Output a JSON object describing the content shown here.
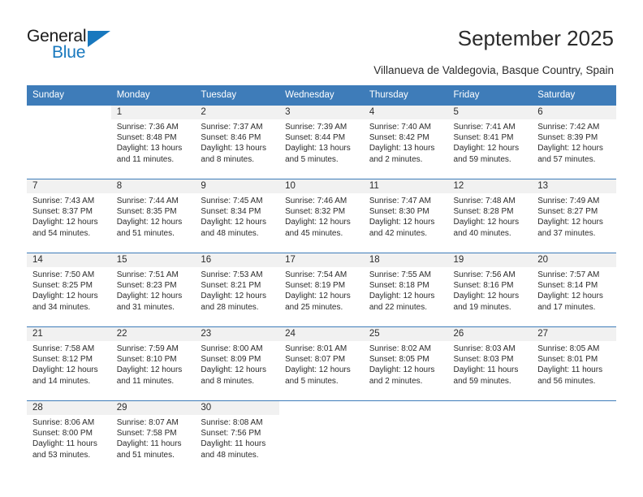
{
  "brand": {
    "name_part1": "General",
    "name_part2": "Blue",
    "accent_color": "#1878be"
  },
  "header": {
    "title": "September 2025",
    "subtitle": "Villanueva de Valdegovia, Basque Country, Spain"
  },
  "calendar": {
    "header_color": "#3e7cb9",
    "daynum_band_color": "#f1f1f1",
    "weekday_headers": [
      "Sunday",
      "Monday",
      "Tuesday",
      "Wednesday",
      "Thursday",
      "Friday",
      "Saturday"
    ],
    "weeks": [
      [
        {
          "day": "",
          "blank": true
        },
        {
          "day": "1",
          "sunrise": "Sunrise: 7:36 AM",
          "sunset": "Sunset: 8:48 PM",
          "daylight": "Daylight: 13 hours and 11 minutes."
        },
        {
          "day": "2",
          "sunrise": "Sunrise: 7:37 AM",
          "sunset": "Sunset: 8:46 PM",
          "daylight": "Daylight: 13 hours and 8 minutes."
        },
        {
          "day": "3",
          "sunrise": "Sunrise: 7:39 AM",
          "sunset": "Sunset: 8:44 PM",
          "daylight": "Daylight: 13 hours and 5 minutes."
        },
        {
          "day": "4",
          "sunrise": "Sunrise: 7:40 AM",
          "sunset": "Sunset: 8:42 PM",
          "daylight": "Daylight: 13 hours and 2 minutes."
        },
        {
          "day": "5",
          "sunrise": "Sunrise: 7:41 AM",
          "sunset": "Sunset: 8:41 PM",
          "daylight": "Daylight: 12 hours and 59 minutes."
        },
        {
          "day": "6",
          "sunrise": "Sunrise: 7:42 AM",
          "sunset": "Sunset: 8:39 PM",
          "daylight": "Daylight: 12 hours and 57 minutes."
        }
      ],
      [
        {
          "day": "7",
          "sunrise": "Sunrise: 7:43 AM",
          "sunset": "Sunset: 8:37 PM",
          "daylight": "Daylight: 12 hours and 54 minutes."
        },
        {
          "day": "8",
          "sunrise": "Sunrise: 7:44 AM",
          "sunset": "Sunset: 8:35 PM",
          "daylight": "Daylight: 12 hours and 51 minutes."
        },
        {
          "day": "9",
          "sunrise": "Sunrise: 7:45 AM",
          "sunset": "Sunset: 8:34 PM",
          "daylight": "Daylight: 12 hours and 48 minutes."
        },
        {
          "day": "10",
          "sunrise": "Sunrise: 7:46 AM",
          "sunset": "Sunset: 8:32 PM",
          "daylight": "Daylight: 12 hours and 45 minutes."
        },
        {
          "day": "11",
          "sunrise": "Sunrise: 7:47 AM",
          "sunset": "Sunset: 8:30 PM",
          "daylight": "Daylight: 12 hours and 42 minutes."
        },
        {
          "day": "12",
          "sunrise": "Sunrise: 7:48 AM",
          "sunset": "Sunset: 8:28 PM",
          "daylight": "Daylight: 12 hours and 40 minutes."
        },
        {
          "day": "13",
          "sunrise": "Sunrise: 7:49 AM",
          "sunset": "Sunset: 8:27 PM",
          "daylight": "Daylight: 12 hours and 37 minutes."
        }
      ],
      [
        {
          "day": "14",
          "sunrise": "Sunrise: 7:50 AM",
          "sunset": "Sunset: 8:25 PM",
          "daylight": "Daylight: 12 hours and 34 minutes."
        },
        {
          "day": "15",
          "sunrise": "Sunrise: 7:51 AM",
          "sunset": "Sunset: 8:23 PM",
          "daylight": "Daylight: 12 hours and 31 minutes."
        },
        {
          "day": "16",
          "sunrise": "Sunrise: 7:53 AM",
          "sunset": "Sunset: 8:21 PM",
          "daylight": "Daylight: 12 hours and 28 minutes."
        },
        {
          "day": "17",
          "sunrise": "Sunrise: 7:54 AM",
          "sunset": "Sunset: 8:19 PM",
          "daylight": "Daylight: 12 hours and 25 minutes."
        },
        {
          "day": "18",
          "sunrise": "Sunrise: 7:55 AM",
          "sunset": "Sunset: 8:18 PM",
          "daylight": "Daylight: 12 hours and 22 minutes."
        },
        {
          "day": "19",
          "sunrise": "Sunrise: 7:56 AM",
          "sunset": "Sunset: 8:16 PM",
          "daylight": "Daylight: 12 hours and 19 minutes."
        },
        {
          "day": "20",
          "sunrise": "Sunrise: 7:57 AM",
          "sunset": "Sunset: 8:14 PM",
          "daylight": "Daylight: 12 hours and 17 minutes."
        }
      ],
      [
        {
          "day": "21",
          "sunrise": "Sunrise: 7:58 AM",
          "sunset": "Sunset: 8:12 PM",
          "daylight": "Daylight: 12 hours and 14 minutes."
        },
        {
          "day": "22",
          "sunrise": "Sunrise: 7:59 AM",
          "sunset": "Sunset: 8:10 PM",
          "daylight": "Daylight: 12 hours and 11 minutes."
        },
        {
          "day": "23",
          "sunrise": "Sunrise: 8:00 AM",
          "sunset": "Sunset: 8:09 PM",
          "daylight": "Daylight: 12 hours and 8 minutes."
        },
        {
          "day": "24",
          "sunrise": "Sunrise: 8:01 AM",
          "sunset": "Sunset: 8:07 PM",
          "daylight": "Daylight: 12 hours and 5 minutes."
        },
        {
          "day": "25",
          "sunrise": "Sunrise: 8:02 AM",
          "sunset": "Sunset: 8:05 PM",
          "daylight": "Daylight: 12 hours and 2 minutes."
        },
        {
          "day": "26",
          "sunrise": "Sunrise: 8:03 AM",
          "sunset": "Sunset: 8:03 PM",
          "daylight": "Daylight: 11 hours and 59 minutes."
        },
        {
          "day": "27",
          "sunrise": "Sunrise: 8:05 AM",
          "sunset": "Sunset: 8:01 PM",
          "daylight": "Daylight: 11 hours and 56 minutes."
        }
      ],
      [
        {
          "day": "28",
          "sunrise": "Sunrise: 8:06 AM",
          "sunset": "Sunset: 8:00 PM",
          "daylight": "Daylight: 11 hours and 53 minutes."
        },
        {
          "day": "29",
          "sunrise": "Sunrise: 8:07 AM",
          "sunset": "Sunset: 7:58 PM",
          "daylight": "Daylight: 11 hours and 51 minutes."
        },
        {
          "day": "30",
          "sunrise": "Sunrise: 8:08 AM",
          "sunset": "Sunset: 7:56 PM",
          "daylight": "Daylight: 11 hours and 48 minutes."
        },
        {
          "day": "",
          "blank": true
        },
        {
          "day": "",
          "blank": true
        },
        {
          "day": "",
          "blank": true
        },
        {
          "day": "",
          "blank": true
        }
      ]
    ]
  }
}
